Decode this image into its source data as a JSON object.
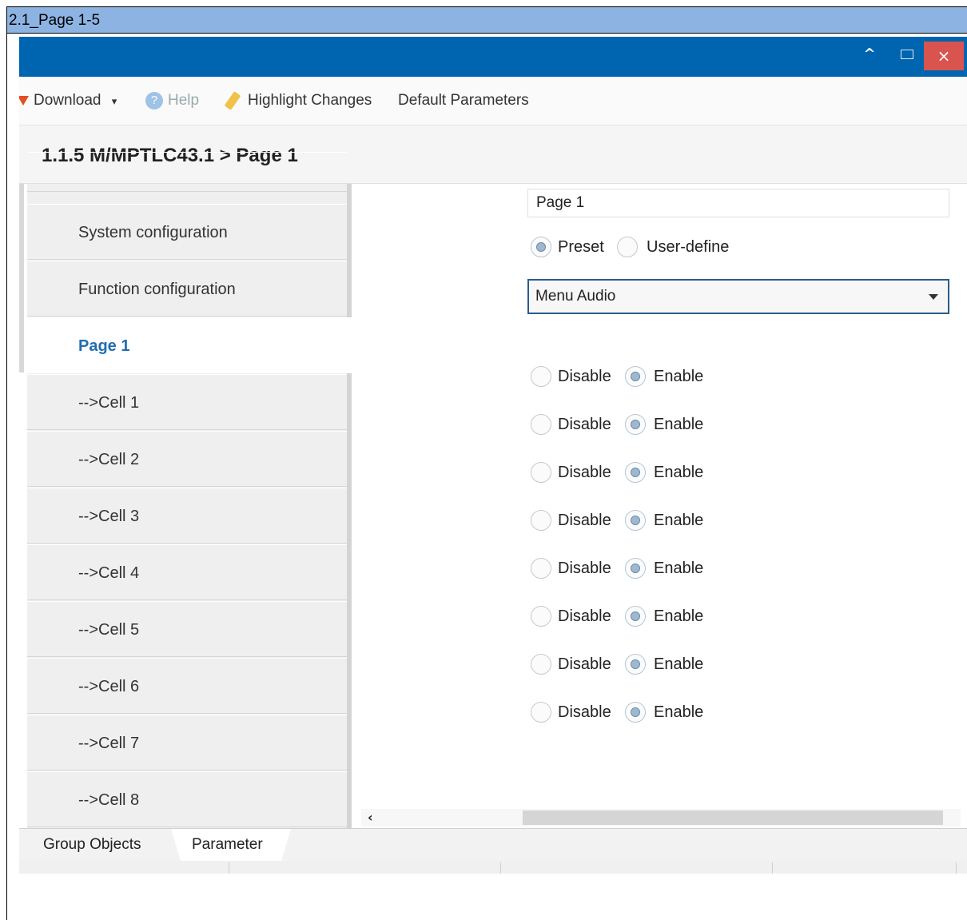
{
  "document": {
    "heading": "2.1_Page 1-5"
  },
  "window": {
    "up_symbol": "^",
    "close_symbol": "×"
  },
  "toolbar": {
    "download": "Download",
    "download_caret": "▾",
    "help": "Help",
    "highlight": "Highlight Changes",
    "defaults": "Default Parameters"
  },
  "breadcrumb": "1.1.5 M/MPTLC43.1 > Page 1",
  "sidebar": {
    "items": [
      {
        "label": "System configuration"
      },
      {
        "label": "Function configuration"
      },
      {
        "label": "Page 1",
        "active": true
      },
      {
        "label": "-->Cell 1"
      },
      {
        "label": "-->Cell 2"
      },
      {
        "label": "-->Cell 3"
      },
      {
        "label": "-->Cell 4"
      },
      {
        "label": "-->Cell 5"
      },
      {
        "label": "-->Cell 6"
      },
      {
        "label": "-->Cell 7"
      },
      {
        "label": "-->Cell 8"
      }
    ]
  },
  "params": {
    "page_name": "Page 1",
    "mode": {
      "preset": "Preset",
      "user_define": "User-define",
      "selected": "Preset"
    },
    "menu_select": "Menu Audio",
    "cells": [
      {
        "disable": "Disable",
        "enable": "Enable",
        "selected": "Enable"
      },
      {
        "disable": "Disable",
        "enable": "Enable",
        "selected": "Enable"
      },
      {
        "disable": "Disable",
        "enable": "Enable",
        "selected": "Enable"
      },
      {
        "disable": "Disable",
        "enable": "Enable",
        "selected": "Enable"
      },
      {
        "disable": "Disable",
        "enable": "Enable",
        "selected": "Enable"
      },
      {
        "disable": "Disable",
        "enable": "Enable",
        "selected": "Enable"
      },
      {
        "disable": "Disable",
        "enable": "Enable",
        "selected": "Enable"
      },
      {
        "disable": "Disable",
        "enable": "Enable",
        "selected": "Enable"
      }
    ]
  },
  "scroll": {
    "left_arrow": "‹"
  },
  "tabs": {
    "group_objects": "Group Objects",
    "parameter": "Parameter",
    "active": "Parameter"
  },
  "colors": {
    "titlebar": "#0065b0",
    "doc_header": "#8db3e2",
    "active_link": "#1f6fb2",
    "close": "#d9534f"
  }
}
